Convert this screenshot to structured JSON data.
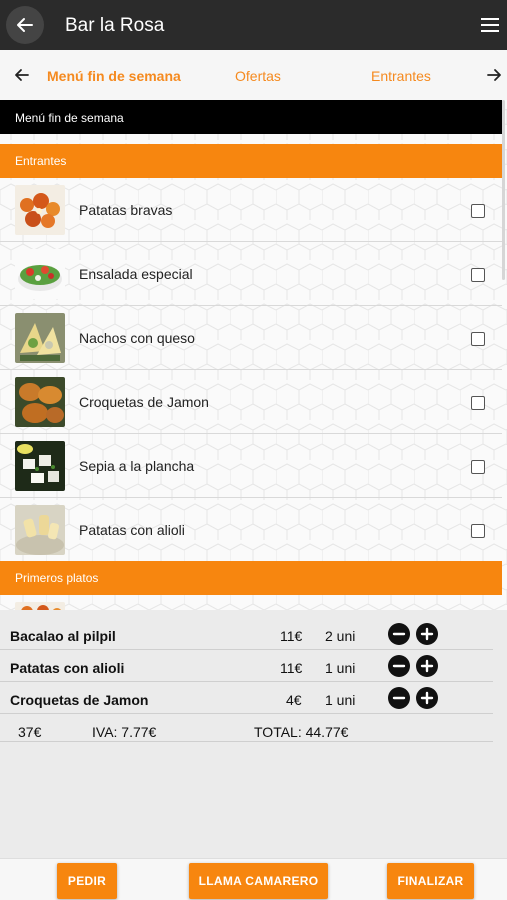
{
  "appbar": {
    "title": "Bar la Rosa"
  },
  "tabs": {
    "items": [
      {
        "label": "Menú fin de semana",
        "active": true
      },
      {
        "label": "Ofertas",
        "active": false
      },
      {
        "label": "Entrantes",
        "active": false
      }
    ]
  },
  "menu": {
    "header": "Menú fin de semana",
    "sections": [
      {
        "title": "Entrantes",
        "dishes": [
          {
            "name": "Patatas bravas",
            "image": "patatas-bravas-photo",
            "checked": false
          },
          {
            "name": "Ensalada especial",
            "image": "ensalada-photo",
            "checked": false
          },
          {
            "name": "Nachos con queso",
            "image": "nachos-photo",
            "checked": false
          },
          {
            "name": "Croquetas de Jamon",
            "image": "croquetas-photo",
            "checked": false
          },
          {
            "name": "Sepia a la plancha",
            "image": "sepia-photo",
            "checked": false
          },
          {
            "name": "Patatas con alioli",
            "image": "alioli-photo",
            "checked": false
          }
        ]
      },
      {
        "title": "Primeros platos",
        "dishes": []
      }
    ]
  },
  "order": {
    "items": [
      {
        "name": "Bacalao al pilpil",
        "price": "11€",
        "qty": "2 uni"
      },
      {
        "name": "Patatas con alioli",
        "price": "11€",
        "qty": "1 uni"
      },
      {
        "name": "Croquetas de Jamon",
        "price": "4€",
        "qty": "1 uni"
      }
    ],
    "subtotal": "37€",
    "iva": "IVA: 7.77€",
    "total": "TOTAL: 44.77€"
  },
  "actions": {
    "pedir": "PEDIR",
    "llama_camarero": "LLAMA CAMARERO",
    "finalizar": "FINALIZAR"
  },
  "colors": {
    "accent": "#f7860f",
    "appbar": "#2b2b2b",
    "tab_text": "#f58a1f"
  }
}
